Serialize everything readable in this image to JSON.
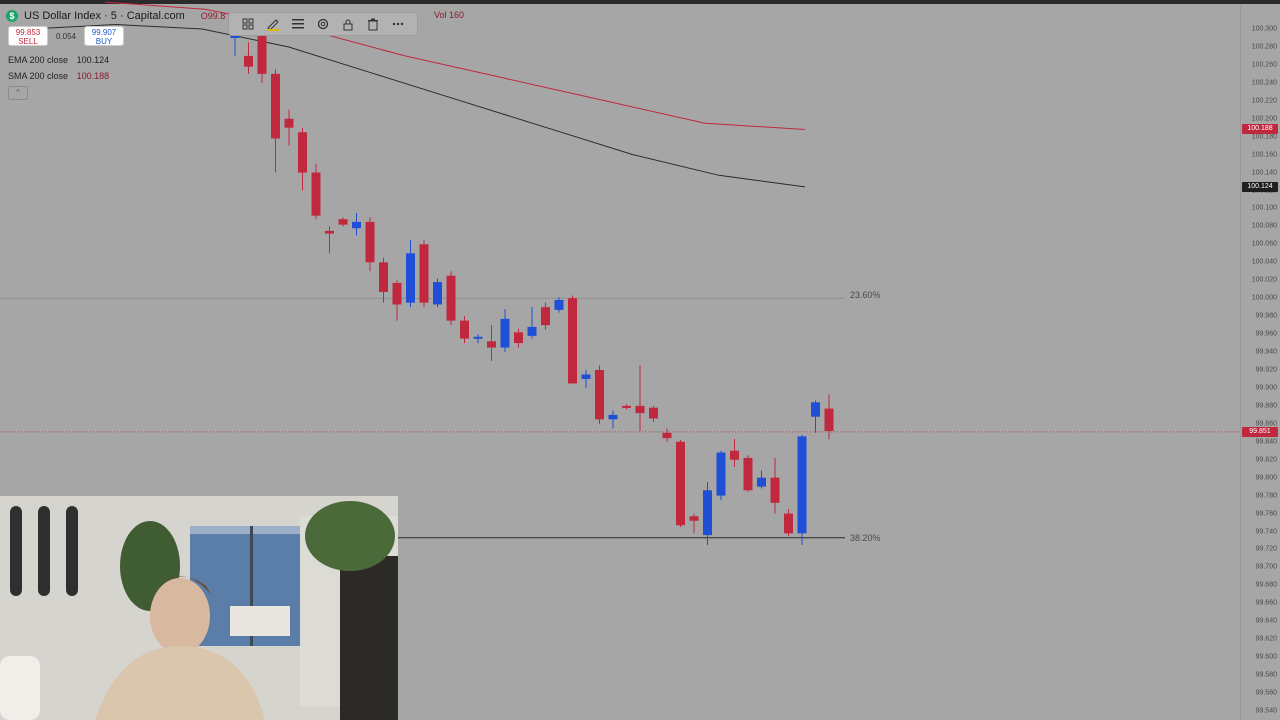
{
  "symbol": {
    "logo": "$",
    "title": "US Dollar Index · 5 · Capital.com",
    "ohlc_text": "O99.8",
    "vol": "Vol 160"
  },
  "trade": {
    "sell_price": "99.853",
    "sell_label": "SELL",
    "spread": "0.054",
    "buy_price": "99.907",
    "buy_label": "BUY"
  },
  "indicators": [
    {
      "name": "EMA 200 close",
      "value": "100.124",
      "color": "#2b2b2b"
    },
    {
      "name": "SMA 200 close",
      "value": "100.188",
      "color": "#c0283e"
    }
  ],
  "collapse_icon": "^",
  "toolbar": {
    "icons": [
      "grid-icon",
      "pencil-icon",
      "menu-icon",
      "settings-icon",
      "lock-icon",
      "trash-icon",
      "more-icon"
    ]
  },
  "fib_levels": [
    {
      "label": "23.60%",
      "price": 100.0
    },
    {
      "label": "38.20%",
      "price": 99.733
    }
  ],
  "price_axis": {
    "ticks": [
      "100.300",
      "100.280",
      "100.260",
      "100.240",
      "100.220",
      "100.200",
      "100.180",
      "100.160",
      "100.140",
      "100.120",
      "100.100",
      "100.080",
      "100.060",
      "100.040",
      "100.020",
      "100.000",
      "99.980",
      "99.960",
      "99.940",
      "99.920",
      "99.900",
      "99.880",
      "99.860",
      "99.840",
      "99.820",
      "99.800",
      "99.780",
      "99.760",
      "99.740",
      "99.720",
      "99.700",
      "99.680",
      "99.660",
      "99.640",
      "99.620",
      "99.600",
      "99.580",
      "99.560",
      "99.540"
    ],
    "badges": [
      {
        "label": "100.188",
        "price": 100.188,
        "color": "#c0283e"
      },
      {
        "label": "100.124",
        "price": 100.124,
        "color": "#1f1f1f"
      },
      {
        "label": "99.851",
        "price": 99.851,
        "color": "#c0283e"
      }
    ]
  },
  "chart_data": {
    "type": "candlestick",
    "ylim": [
      99.54,
      100.31
    ],
    "up_color": "#1f4fd6",
    "down_color": "#c0283e",
    "candles": [
      {
        "o": 100.29,
        "h": 100.305,
        "l": 100.27,
        "c": 100.298
      },
      {
        "o": 100.27,
        "h": 100.285,
        "l": 100.25,
        "c": 100.258
      },
      {
        "o": 100.3,
        "h": 100.305,
        "l": 100.24,
        "c": 100.25
      },
      {
        "o": 100.25,
        "h": 100.255,
        "l": 100.14,
        "c": 100.178
      },
      {
        "o": 100.2,
        "h": 100.21,
        "l": 100.17,
        "c": 100.19
      },
      {
        "o": 100.185,
        "h": 100.19,
        "l": 100.12,
        "c": 100.14
      },
      {
        "o": 100.14,
        "h": 100.15,
        "l": 100.088,
        "c": 100.092
      },
      {
        "o": 100.075,
        "h": 100.08,
        "l": 100.05,
        "c": 100.072
      },
      {
        "o": 100.088,
        "h": 100.09,
        "l": 100.08,
        "c": 100.082
      },
      {
        "o": 100.078,
        "h": 100.095,
        "l": 100.07,
        "c": 100.085
      },
      {
        "o": 100.085,
        "h": 100.09,
        "l": 100.03,
        "c": 100.04
      },
      {
        "o": 100.04,
        "h": 100.045,
        "l": 99.995,
        "c": 100.007
      },
      {
        "o": 100.017,
        "h": 100.02,
        "l": 99.975,
        "c": 99.993
      },
      {
        "o": 99.995,
        "h": 100.065,
        "l": 99.99,
        "c": 100.05
      },
      {
        "o": 100.06,
        "h": 100.065,
        "l": 99.99,
        "c": 99.995
      },
      {
        "o": 99.993,
        "h": 100.022,
        "l": 99.99,
        "c": 100.018
      },
      {
        "o": 100.025,
        "h": 100.03,
        "l": 99.97,
        "c": 99.975
      },
      {
        "o": 99.975,
        "h": 99.98,
        "l": 99.95,
        "c": 99.955
      },
      {
        "o": 99.955,
        "h": 99.96,
        "l": 99.95,
        "c": 99.957
      },
      {
        "o": 99.952,
        "h": 99.97,
        "l": 99.93,
        "c": 99.945
      },
      {
        "o": 99.945,
        "h": 99.988,
        "l": 99.94,
        "c": 99.977
      },
      {
        "o": 99.962,
        "h": 99.966,
        "l": 99.945,
        "c": 99.95
      },
      {
        "o": 99.958,
        "h": 99.99,
        "l": 99.955,
        "c": 99.968
      },
      {
        "o": 99.99,
        "h": 99.995,
        "l": 99.965,
        "c": 99.97
      },
      {
        "o": 99.987,
        "h": 100.001,
        "l": 99.984,
        "c": 99.998
      },
      {
        "o": 100.0,
        "h": 100.003,
        "l": 99.905,
        "c": 99.905
      },
      {
        "o": 99.91,
        "h": 99.92,
        "l": 99.9,
        "c": 99.915
      },
      {
        "o": 99.92,
        "h": 99.925,
        "l": 99.86,
        "c": 99.865
      },
      {
        "o": 99.865,
        "h": 99.875,
        "l": 99.855,
        "c": 99.87
      },
      {
        "o": 99.88,
        "h": 99.882,
        "l": 99.876,
        "c": 99.878
      },
      {
        "o": 99.88,
        "h": 99.925,
        "l": 99.852,
        "c": 99.872
      },
      {
        "o": 99.878,
        "h": 99.88,
        "l": 99.862,
        "c": 99.866
      },
      {
        "o": 99.85,
        "h": 99.855,
        "l": 99.84,
        "c": 99.844
      },
      {
        "o": 99.84,
        "h": 99.842,
        "l": 99.745,
        "c": 99.747
      },
      {
        "o": 99.757,
        "h": 99.76,
        "l": 99.738,
        "c": 99.752
      },
      {
        "o": 99.736,
        "h": 99.795,
        "l": 99.725,
        "c": 99.786
      },
      {
        "o": 99.78,
        "h": 99.83,
        "l": 99.775,
        "c": 99.828
      },
      {
        "o": 99.83,
        "h": 99.843,
        "l": 99.812,
        "c": 99.82
      },
      {
        "o": 99.822,
        "h": 99.825,
        "l": 99.784,
        "c": 99.786
      },
      {
        "o": 99.79,
        "h": 99.808,
        "l": 99.788,
        "c": 99.8
      },
      {
        "o": 99.8,
        "h": 99.822,
        "l": 99.76,
        "c": 99.772
      },
      {
        "o": 99.76,
        "h": 99.765,
        "l": 99.735,
        "c": 99.738
      },
      {
        "o": 99.738,
        "h": 99.848,
        "l": 99.725,
        "c": 99.846
      },
      {
        "o": 99.868,
        "h": 99.886,
        "l": 99.85,
        "c": 99.884
      },
      {
        "o": 99.877,
        "h": 99.893,
        "l": 99.843,
        "c": 99.852
      }
    ],
    "ema200": [
      100.3,
      100.305,
      100.3,
      100.28,
      100.25,
      100.22,
      100.19,
      100.16,
      100.137,
      100.124
    ],
    "sma200": [
      100.33,
      100.322,
      100.3,
      100.27,
      100.245,
      100.22,
      100.195,
      100.188
    ]
  }
}
